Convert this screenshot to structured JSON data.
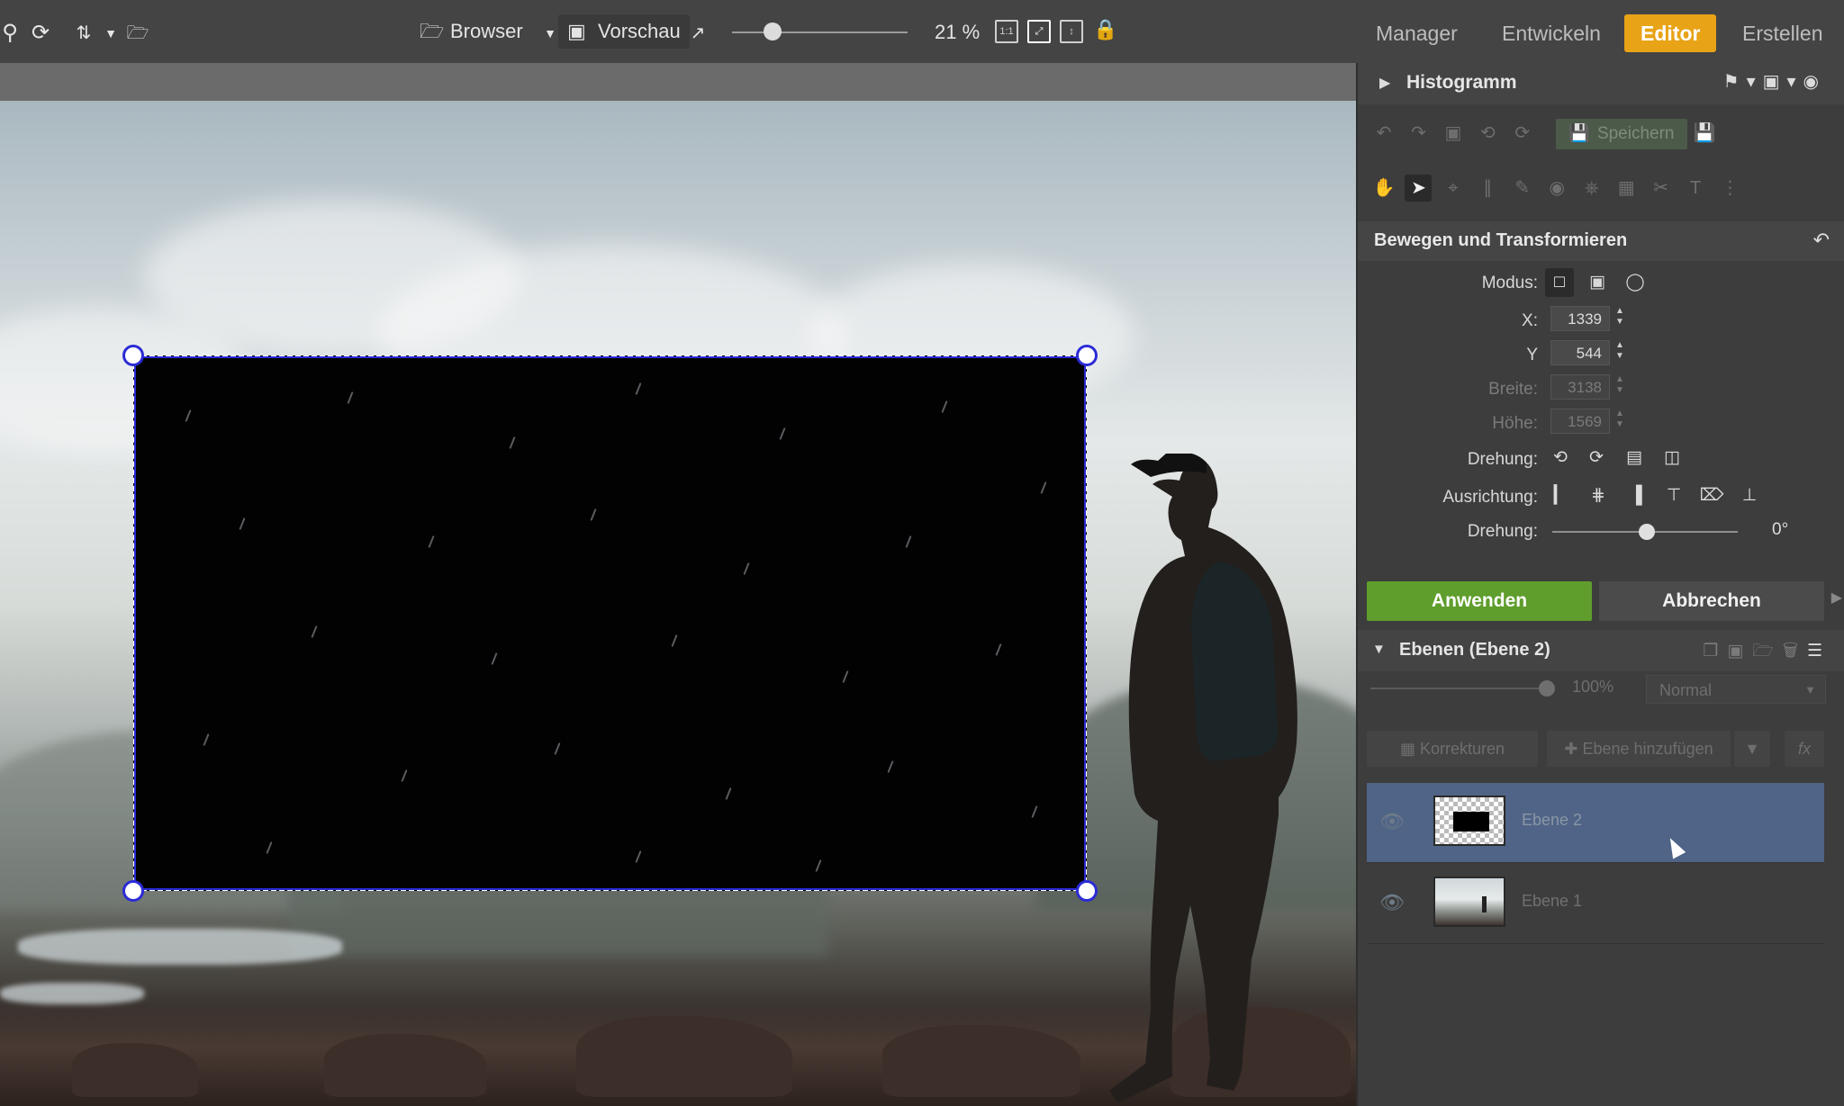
{
  "toolbar": {
    "icons_left": [
      "search-icon",
      "refresh-icon",
      "sort-icon",
      "chevron-down-icon",
      "folder-add-icon"
    ],
    "browser_label": "Browser",
    "preview_label": "Vorschau",
    "zoom_label": "21 %",
    "zoom_level": 0.21
  },
  "nav": {
    "tabs": [
      {
        "label": "Manager",
        "active": false
      },
      {
        "label": "Entwickeln",
        "active": false
      },
      {
        "label": "Editor",
        "active": true
      },
      {
        "label": "Erstellen",
        "active": false
      }
    ],
    "accent_color": "#e8a317"
  },
  "panel": {
    "histogram_title": "Histogramm",
    "save_label": "Speichern",
    "transform": {
      "title": "Bewegen und Transformieren",
      "mode_label": "Modus:",
      "x_label": "X:",
      "x_value": "1339",
      "y_label": "Y",
      "y_value": "544",
      "width_label": "Breite:",
      "width_value": "3138",
      "height_label": "Höhe:",
      "height_value": "1569",
      "rotation_label": "Drehung:",
      "alignment_label": "Ausrichtung:",
      "angle_label": "Drehung:",
      "angle_value": "0°"
    },
    "apply_label": "Anwenden",
    "cancel_label": "Abbrechen",
    "layers": {
      "title": "Ebenen (Ebene 2)",
      "opacity": "100%",
      "blend_mode": "Normal",
      "corrections_label": "Korrekturen",
      "add_layer_label": "Ebene hinzufügen",
      "fx_label": "fx",
      "items": [
        {
          "name": "Ebene 2",
          "selected": true
        },
        {
          "name": "Ebene 1",
          "selected": false
        }
      ]
    }
  }
}
